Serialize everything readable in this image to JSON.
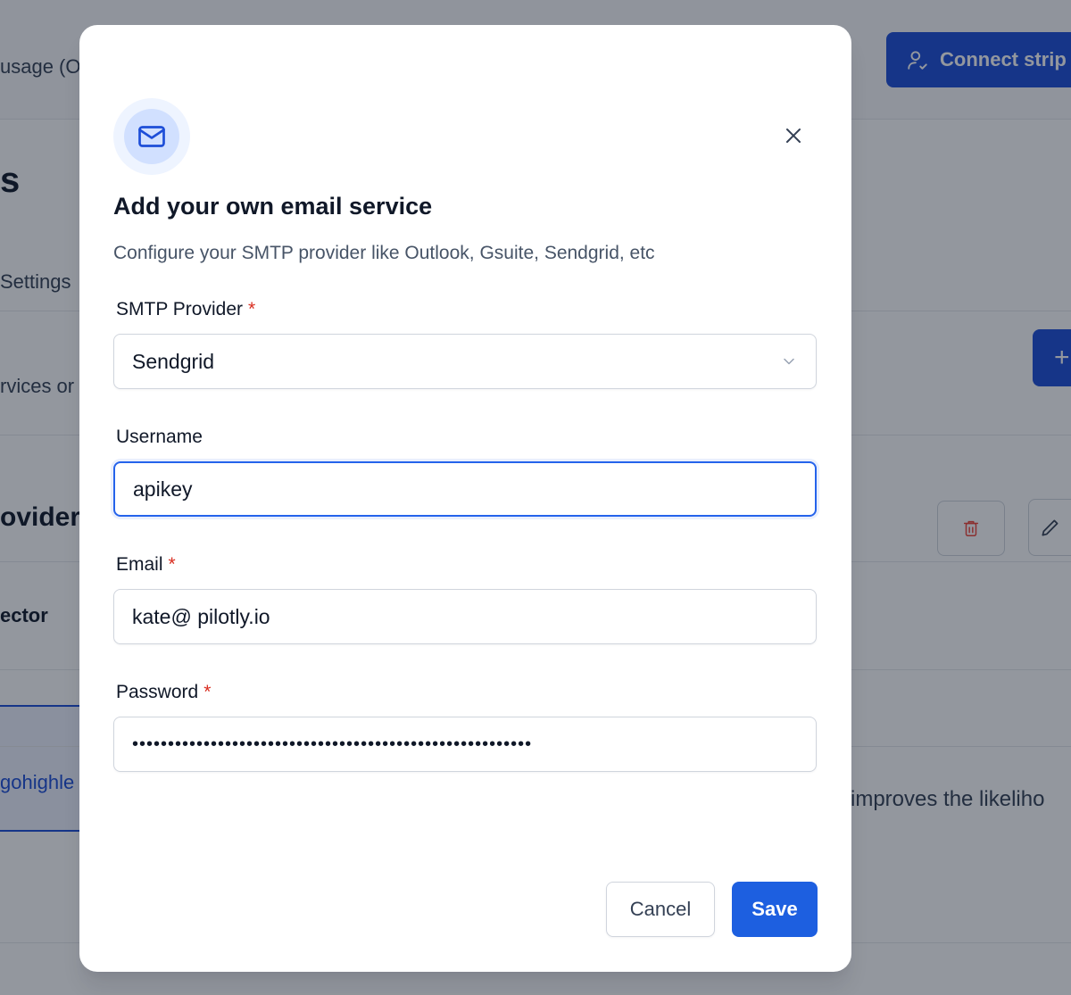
{
  "background": {
    "header_fragment": "usage (O",
    "connect_button_label": "Connect strip",
    "heading_fragment": "s",
    "settings_fragment": "Settings",
    "services_fragment": "rvices or",
    "provider_heading_fragment": "ovider",
    "connector_fragment": "ector",
    "selected_item_fragment": "gohighle",
    "likelihood_fragment": "improves the likeliho",
    "plus_label": "+"
  },
  "modal": {
    "title": "Add your own email service",
    "subtitle": "Configure your SMTP provider like Outlook, Gsuite, Sendgrid, etc",
    "icon": "mail-icon",
    "close_icon": "close-icon",
    "fields": {
      "provider": {
        "label": "SMTP Provider",
        "required_mark": "*",
        "value": "Sendgrid"
      },
      "username": {
        "label": "Username",
        "value": "apikey"
      },
      "email": {
        "label": "Email",
        "required_mark": "*",
        "value": "kate@ pilotly.io"
      },
      "password": {
        "label": "Password",
        "required_mark": "*",
        "masked": "••••••••••••••••••••••••••••••••••••••••••••••••••••••••"
      }
    },
    "actions": {
      "cancel_label": "Cancel",
      "save_label": "Save"
    }
  },
  "colors": {
    "primary": "#1d4ed8",
    "required": "#d92d20",
    "focus_ring": "#2563eb"
  }
}
